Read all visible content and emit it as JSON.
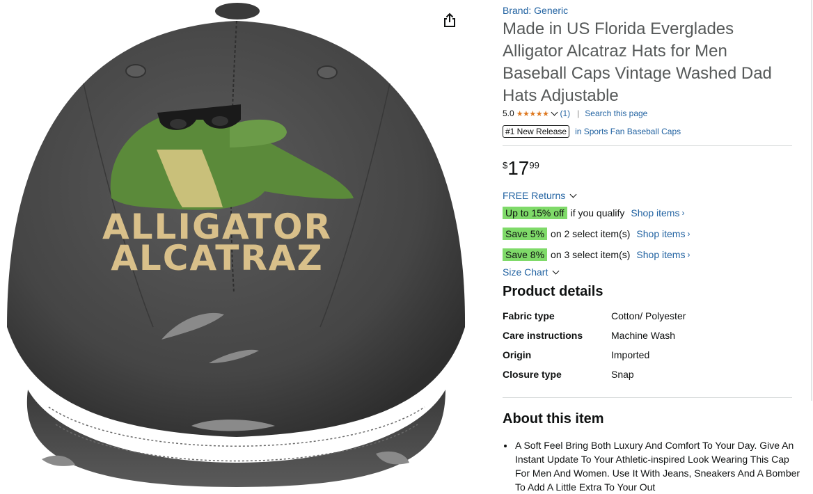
{
  "image": {
    "hat_print_line1": "ALLIGATOR",
    "hat_print_line2": "ALCATRAZ",
    "share_icon": "share-icon"
  },
  "product": {
    "brand": "Brand: Generic",
    "title": "Made in US Florida Everglades Alligator Alcatraz Hats for Men Baseball Caps Vintage Washed Dad Hats Adjustable",
    "rating": "5.0",
    "stars": "★★★★★",
    "rating_count": "(1)",
    "search_page": "Search this page",
    "release_badge": "#1 New Release",
    "release_category": "in Sports Fan Baseball Caps",
    "price_symbol": "$",
    "price_whole": "17",
    "price_fraction": "99"
  },
  "offers": {
    "returns": "FREE Returns",
    "promos": [
      {
        "badge": "Up to 15% off",
        "text": "if you qualify",
        "link": "Shop items"
      },
      {
        "badge": "Save 5%",
        "text": "on 2 select item(s)",
        "link": "Shop items"
      },
      {
        "badge": "Save 8%",
        "text": "on 3 select item(s)",
        "link": "Shop items"
      }
    ],
    "size_chart": "Size Chart"
  },
  "details": {
    "heading": "Product details",
    "rows": [
      {
        "key": "Fabric type",
        "value": "Cotton/ Polyester"
      },
      {
        "key": "Care instructions",
        "value": "Machine Wash"
      },
      {
        "key": "Origin",
        "value": "Imported"
      },
      {
        "key": "Closure type",
        "value": "Snap"
      }
    ]
  },
  "about": {
    "heading": "About this item",
    "bullets": [
      "A Soft Feel Bring Both Luxury And Comfort To Your Day. Give An Instant Update To Your Athletic-inspired Look Wearing This Cap For Men And Women. Use It With Jeans, Sneakers And A Bomber To Add A Little Extra To Your Out"
    ]
  },
  "colors": {
    "link": "#2162a1",
    "promo_badge": "#7fda69",
    "stars": "#de7921",
    "hat": "#4a4a4a",
    "print_text": "#d9c08a",
    "gator": "#5b8a3a"
  }
}
